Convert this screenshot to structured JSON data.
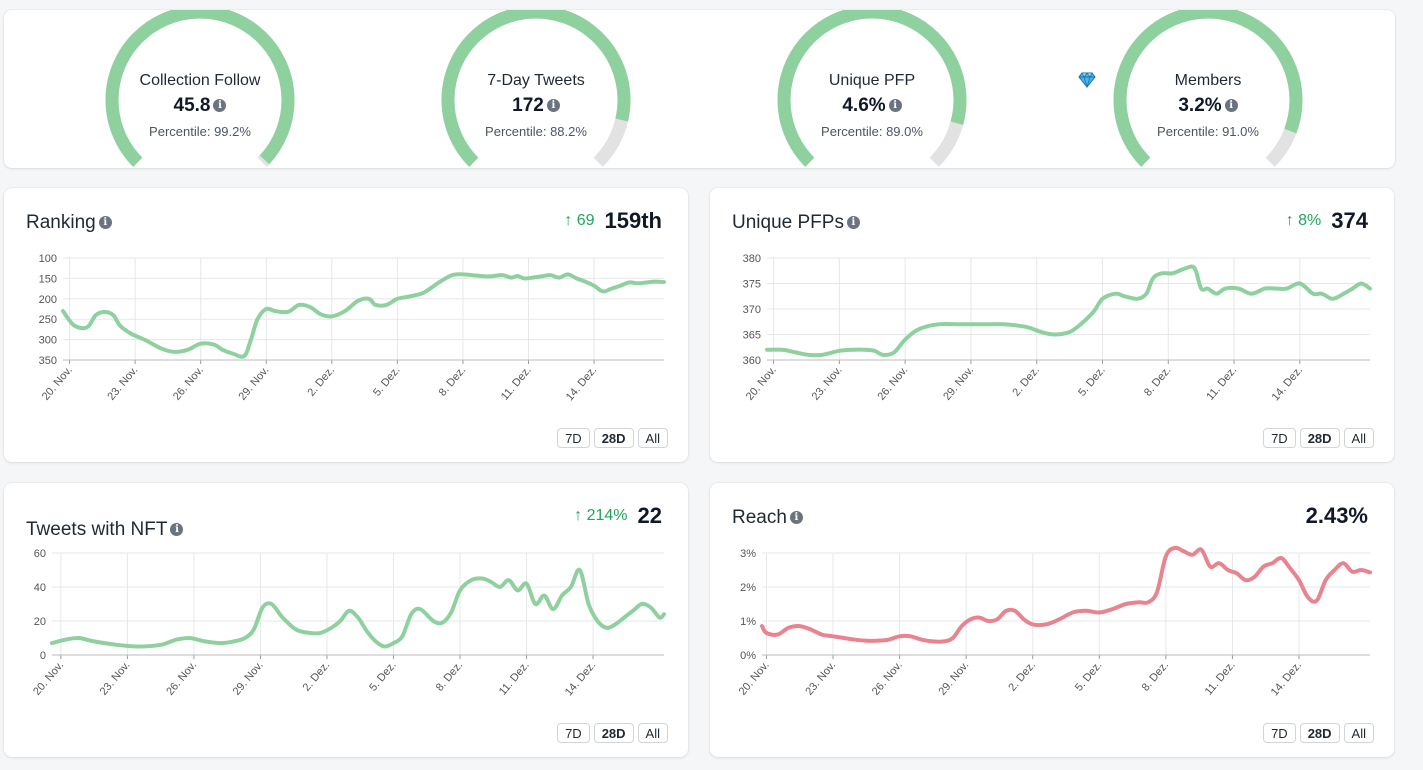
{
  "gauges": [
    {
      "title": "Collection Follow",
      "value": "45.8",
      "percentile_text": "Percentile: 99.2%",
      "percentile": 99.2,
      "icon": "info-icon"
    },
    {
      "title": "7-Day Tweets",
      "value": "172",
      "percentile_text": "Percentile: 88.2%",
      "percentile": 88.2,
      "icon": "info-icon"
    },
    {
      "title": "Unique PFP",
      "value": "4.6%",
      "percentile_text": "Percentile: 89.0%",
      "percentile": 89.0,
      "icon": "info-icon"
    },
    {
      "title": "Members",
      "value": "3.2%",
      "percentile_text": "Percentile: 91.0%",
      "percentile": 91.0,
      "icon": "info-icon",
      "prefix_icon": "gem-icon"
    }
  ],
  "colors": {
    "green": "#8fd19e",
    "red": "#e8848f",
    "track": "#e2e2e2",
    "up": "#22a55b"
  },
  "range_buttons": [
    "7D",
    "28D",
    "All"
  ],
  "active_range": "28D",
  "x_ticks": [
    "20. Nov.",
    "23. Nov.",
    "26. Nov.",
    "29. Nov.",
    "2. Dez.",
    "5. Dez.",
    "8. Dez.",
    "11. Dez.",
    "14. Dez."
  ],
  "charts": {
    "ranking": {
      "title": "Ranking",
      "change": "69",
      "value": "159th"
    },
    "unique_pfps": {
      "title": "Unique PFPs",
      "change": "8%",
      "value": "374"
    },
    "tweets": {
      "title": "Tweets with NFT",
      "change": "214%",
      "value": "22"
    },
    "reach": {
      "title": "Reach",
      "change": "",
      "value": "2.43%"
    }
  },
  "chart_data": [
    {
      "id": "ranking",
      "type": "line",
      "title": "Ranking",
      "color": "#8fd19e",
      "inverted_y": true,
      "ylim": [
        100,
        350
      ],
      "yticks": [
        "100",
        "150",
        "200",
        "250",
        "300",
        "350"
      ],
      "ytick_values": [
        100,
        150,
        200,
        250,
        300,
        350
      ],
      "x_range": [
        19.7,
        47.2
      ],
      "xtick_days": [
        20,
        23,
        26,
        29,
        32,
        35,
        38,
        41,
        44
      ],
      "series": [
        {
          "x": [
            19.6,
            20.2,
            20.8,
            21.2,
            21.6,
            22.0,
            22.3,
            22.8,
            23.5,
            24.2,
            24.8,
            25.4,
            26.0,
            26.6,
            27.0,
            27.5,
            28.0,
            28.3,
            28.6,
            29.0,
            29.4,
            30.0,
            30.5,
            31.0,
            31.5,
            32.0,
            32.6,
            33.2,
            33.7,
            34.0,
            34.5,
            35.0,
            35.5,
            36.2,
            36.9,
            37.5,
            38.0,
            38.6,
            39.2,
            39.8,
            40.2,
            40.5,
            40.8,
            41.2,
            41.6,
            42.0,
            42.4,
            42.8,
            43.2,
            43.6,
            44.0,
            44.4,
            44.8,
            45.2,
            45.6,
            46.0,
            46.4,
            46.8,
            47.2
          ],
          "y": [
            230,
            265,
            270,
            240,
            232,
            240,
            265,
            285,
            302,
            322,
            330,
            325,
            310,
            312,
            325,
            335,
            340,
            300,
            250,
            225,
            230,
            232,
            215,
            220,
            238,
            243,
            230,
            205,
            200,
            215,
            215,
            200,
            195,
            185,
            160,
            142,
            140,
            143,
            145,
            142,
            148,
            144,
            150,
            148,
            145,
            142,
            148,
            140,
            150,
            158,
            168,
            182,
            175,
            168,
            160,
            162,
            160,
            158,
            159
          ]
        }
      ]
    },
    {
      "id": "unique_pfps",
      "type": "line",
      "title": "Unique PFPs",
      "color": "#8fd19e",
      "inverted_y": false,
      "ylim": [
        360,
        380
      ],
      "yticks": [
        "360",
        "365",
        "370",
        "375",
        "380"
      ],
      "ytick_values": [
        360,
        365,
        370,
        375,
        380
      ],
      "x_range": [
        19.7,
        47.2
      ],
      "xtick_days": [
        20,
        23,
        26,
        29,
        32,
        35,
        38,
        41,
        44
      ],
      "series": [
        {
          "x": [
            19.6,
            20.4,
            21.0,
            21.6,
            22.2,
            23.0,
            23.6,
            24.2,
            24.6,
            25.0,
            25.5,
            26.0,
            26.6,
            27.5,
            28.5,
            29.5,
            30.5,
            31.5,
            32.2,
            32.8,
            33.5,
            34.0,
            34.6,
            35.0,
            35.6,
            36.0,
            36.6,
            37.0,
            37.3,
            37.7,
            38.2,
            38.8,
            39.2,
            39.5,
            39.8,
            40.2,
            40.6,
            41.2,
            41.8,
            42.4,
            42.9,
            43.4,
            44.0,
            44.6,
            45.0,
            45.5,
            46.0,
            46.4,
            46.8,
            47.2
          ],
          "y": [
            362,
            362,
            361.5,
            361,
            361,
            361.8,
            362,
            362,
            361.8,
            361,
            361.5,
            364,
            366,
            367,
            367,
            367,
            367,
            366.5,
            365.5,
            365,
            365.5,
            367,
            369.5,
            372,
            373,
            372.5,
            372,
            373,
            376,
            377,
            377,
            378,
            378,
            374,
            374,
            373,
            374,
            374,
            373,
            374,
            374,
            374,
            375,
            373,
            373,
            372,
            373,
            374,
            375,
            374
          ]
        }
      ]
    },
    {
      "id": "tweets",
      "type": "line",
      "title": "Tweets with NFT",
      "color": "#8fd19e",
      "inverted_y": false,
      "ylim": [
        0,
        60
      ],
      "yticks": [
        "0",
        "20",
        "40",
        "60"
      ],
      "ytick_values": [
        0,
        20,
        40,
        60
      ],
      "x_range": [
        19.6,
        47.2
      ],
      "xtick_days": [
        20,
        23,
        26,
        29,
        32,
        35,
        38,
        41,
        44
      ],
      "series": [
        {
          "x": [
            19.5,
            20.2,
            20.8,
            21.5,
            22.5,
            23.5,
            24.5,
            25.2,
            25.8,
            26.5,
            27.2,
            27.8,
            28.3,
            28.7,
            29.1,
            29.5,
            30.0,
            30.6,
            31.2,
            31.7,
            32.2,
            32.6,
            33.0,
            33.4,
            33.8,
            34.2,
            34.6,
            35.0,
            35.4,
            35.8,
            36.2,
            36.8,
            37.2,
            37.6,
            38.0,
            38.5,
            39.0,
            39.4,
            39.8,
            40.2,
            40.6,
            41.0,
            41.4,
            41.8,
            42.2,
            42.6,
            43.0,
            43.4,
            43.8,
            44.2,
            44.6,
            45.0,
            45.4,
            45.8,
            46.2,
            46.6,
            47.0,
            47.2
          ],
          "y": [
            7,
            9,
            10,
            8,
            6,
            5,
            6,
            9,
            10,
            8,
            7,
            8,
            10,
            15,
            28,
            30,
            22,
            15,
            13,
            13,
            16,
            20,
            26,
            22,
            14,
            8,
            5,
            7,
            11,
            24,
            27,
            20,
            19,
            25,
            38,
            44,
            45,
            43,
            40,
            44,
            38,
            42,
            30,
            35,
            27,
            35,
            40,
            50,
            30,
            20,
            16,
            18,
            22,
            26,
            30,
            28,
            22,
            24
          ]
        }
      ]
    },
    {
      "id": "reach",
      "type": "line",
      "title": "Reach",
      "color": "#e8848f",
      "inverted_y": false,
      "ylim": [
        0,
        3
      ],
      "yticks": [
        "0%",
        "1%",
        "2%",
        "3%"
      ],
      "ytick_values": [
        0,
        1,
        2,
        3
      ],
      "x_range": [
        19.8,
        47.2
      ],
      "xtick_days": [
        20,
        23,
        26,
        29,
        32,
        35,
        38,
        41,
        44
      ],
      "series": [
        {
          "x": [
            19.5,
            20.0,
            20.5,
            21.0,
            21.5,
            22.0,
            22.5,
            23.0,
            23.5,
            24.0,
            24.5,
            25.0,
            25.5,
            26.0,
            26.5,
            27.0,
            27.5,
            28.0,
            28.4,
            28.8,
            29.2,
            29.6,
            30.0,
            30.4,
            30.8,
            31.2,
            31.6,
            32.0,
            32.6,
            33.2,
            33.8,
            34.4,
            35.0,
            35.6,
            36.2,
            36.8,
            37.2,
            37.6,
            38.0,
            38.4,
            38.8,
            39.2,
            39.6,
            40.0,
            40.4,
            40.8,
            41.2,
            41.6,
            42.0,
            42.4,
            42.8,
            43.2,
            43.6,
            44.0,
            44.4,
            44.8,
            45.2,
            45.6,
            46.0,
            46.4,
            46.8,
            47.2
          ],
          "y": [
            0.85,
            0.65,
            0.6,
            0.8,
            0.85,
            0.75,
            0.6,
            0.55,
            0.5,
            0.45,
            0.42,
            0.42,
            0.45,
            0.55,
            0.55,
            0.45,
            0.4,
            0.4,
            0.5,
            0.85,
            1.05,
            1.1,
            1.0,
            1.05,
            1.3,
            1.3,
            1.05,
            0.9,
            0.9,
            1.05,
            1.25,
            1.3,
            1.25,
            1.35,
            1.5,
            1.55,
            1.55,
            1.85,
            2.9,
            3.15,
            3.05,
            2.95,
            3.1,
            2.6,
            2.7,
            2.5,
            2.4,
            2.2,
            2.3,
            2.6,
            2.7,
            2.85,
            2.55,
            2.2,
            1.7,
            1.6,
            2.2,
            2.5,
            2.7,
            2.45,
            2.5,
            2.43
          ]
        }
      ]
    }
  ]
}
